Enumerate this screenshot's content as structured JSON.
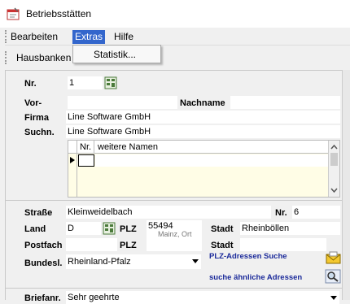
{
  "window": {
    "title": "Betriebsstätten"
  },
  "menu": {
    "items": [
      "Bearbeiten",
      "Extras",
      "Hilfe"
    ],
    "open_menu": {
      "label": "Extras",
      "items": [
        "Statistik..."
      ]
    }
  },
  "toolbar": {
    "label": "Hausbanken"
  },
  "form": {
    "nr": {
      "label": "Nr.",
      "value": "1"
    },
    "vor": {
      "label": "Vor-",
      "value": ""
    },
    "nachname": {
      "label": "Nachname"
    },
    "firma": {
      "label": "Firma",
      "value": "Line Software GmbH"
    },
    "suchn": {
      "label": "Suchn.",
      "value": "Line Software GmbH"
    },
    "names_grid": {
      "col_nr": "Nr.",
      "col_names": "weitere Namen"
    },
    "strasse": {
      "label": "Straße",
      "value": "Kleinweidelbach"
    },
    "hausnr": {
      "label": "Nr.",
      "value": "6"
    },
    "land": {
      "label": "Land",
      "value": "D"
    },
    "plz": {
      "label": "PLZ",
      "value": "55494"
    },
    "plz_overlay": "Mainz, Ort",
    "stadt": {
      "label": "Stadt",
      "value": "Rheinböllen"
    },
    "postfach": {
      "label": "Postfach",
      "value": ""
    },
    "plz2": {
      "label": "PLZ",
      "value": ""
    },
    "stadt2": {
      "label": "Stadt",
      "value": ""
    },
    "bundesland": {
      "label": "Bundesl.",
      "value": "Rheinland-Pfalz"
    },
    "plz_search_link": "PLZ-Adressen Suche",
    "similar_link": "suche ähnliche Adressen",
    "briefanrede": {
      "label": "Briefanr.",
      "value": "Sehr geehrte"
    }
  },
  "colors": {
    "accent": "#3366cc",
    "link": "#1b2a9a",
    "grid_bg": "#fffde6"
  }
}
